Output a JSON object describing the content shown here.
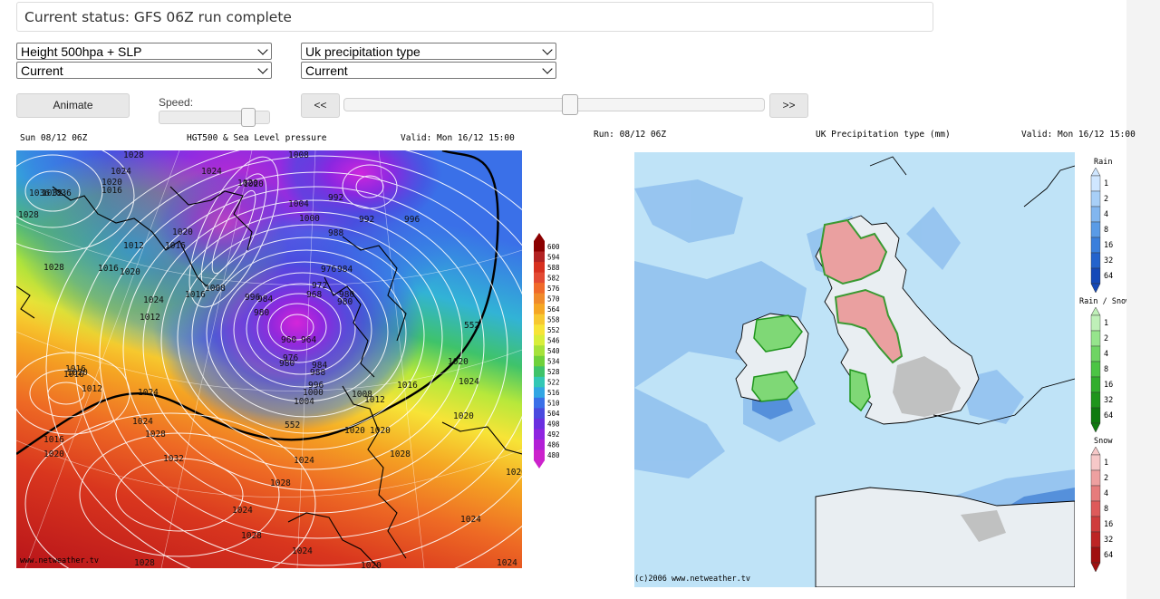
{
  "status_text": "Current status: GFS 06Z run complete",
  "left_panel": {
    "chart_select": "Height 500hpa + SLP",
    "run_select": "Current",
    "title_left": "Sun 08/12 06Z",
    "title_center": "HGT500 & Sea Level pressure",
    "title_right": "Valid: Mon 16/12 15:00",
    "credit": "www.netweather.tv",
    "scale_labels": [
      "600",
      "594",
      "588",
      "582",
      "576",
      "570",
      "564",
      "558",
      "552",
      "546",
      "540",
      "534",
      "528",
      "522",
      "516",
      "510",
      "504",
      "498",
      "492",
      "486",
      "480"
    ],
    "scale_colors": [
      "#8b0000",
      "#b22222",
      "#d7301f",
      "#e34a33",
      "#f06a2a",
      "#f08a2a",
      "#f5a623",
      "#f7c830",
      "#f7e437",
      "#d8ee3a",
      "#a6e23a",
      "#6fd13b",
      "#3fc36a",
      "#33c7b5",
      "#32a6e3",
      "#3a70e8",
      "#4a4adf",
      "#6a2fe0",
      "#8f24e0",
      "#b21fd6",
      "#cc22cc"
    ],
    "contour_labels": [
      "1028",
      "1024",
      "1036",
      "1032",
      "1028",
      "1020",
      "1016",
      "1024",
      "1020",
      "1008",
      "1012",
      "1016",
      "1020",
      "1024",
      "1012",
      "1016",
      "1020",
      "1028",
      "1016",
      "1036",
      "1008",
      "996",
      "984",
      "980",
      "1020",
      "1004",
      "1000",
      "992",
      "988",
      "992",
      "996",
      "976",
      "984",
      "972",
      "968",
      "980",
      "980",
      "960",
      "964",
      "980",
      "976",
      "984",
      "988",
      "996",
      "1000",
      "1004",
      "1008",
      "1012",
      "1020",
      "1020",
      "1016",
      "1012",
      "1024",
      "1024",
      "1028",
      "1032",
      "1028",
      "1024",
      "1028",
      "1024",
      "1020",
      "1016",
      "1020",
      "1020",
      "1016",
      "1016",
      "1020",
      "552",
      "552",
      "1024",
      "1028",
      "1024",
      "1020",
      "1024",
      "1020",
      "1028",
      "1024"
    ]
  },
  "right_panel": {
    "chart_select": "Uk precipitation type",
    "run_select": "Current",
    "title_left": "Run: 08/12 06Z",
    "title_center": "UK Precipitation type (mm)",
    "title_right": "Valid: Mon 16/12 15:00",
    "credit": "(c)2006 www.netweather.tv",
    "legend": [
      {
        "title": "Rain",
        "levels": [
          "1",
          "2",
          "4",
          "8",
          "16",
          "32",
          "64"
        ],
        "colors": [
          "#cfe6ff",
          "#a8cff7",
          "#82b6ef",
          "#5a9be6",
          "#3a7fdc",
          "#2463cc",
          "#1549b8"
        ]
      },
      {
        "title": "Rain / Snow",
        "levels": [
          "1",
          "2",
          "4",
          "8",
          "16",
          "32",
          "64"
        ],
        "colors": [
          "#bff0b8",
          "#96e48c",
          "#6fd464",
          "#4cc444",
          "#31ae2c",
          "#1f951c",
          "#0f7a0f"
        ]
      },
      {
        "title": "Snow",
        "levels": [
          "1",
          "2",
          "4",
          "8",
          "16",
          "32",
          "64"
        ],
        "colors": [
          "#f6c8c8",
          "#eea0a0",
          "#e67c7c",
          "#dd5a5a",
          "#cf3c3c",
          "#bd2424",
          "#a01010"
        ]
      }
    ]
  },
  "controls": {
    "animate_label": "Animate",
    "speed_label": "Speed:",
    "prev_label": "<<",
    "next_label": ">>",
    "speed_value_fraction": 0.8,
    "frame_position_fraction": 0.54
  }
}
